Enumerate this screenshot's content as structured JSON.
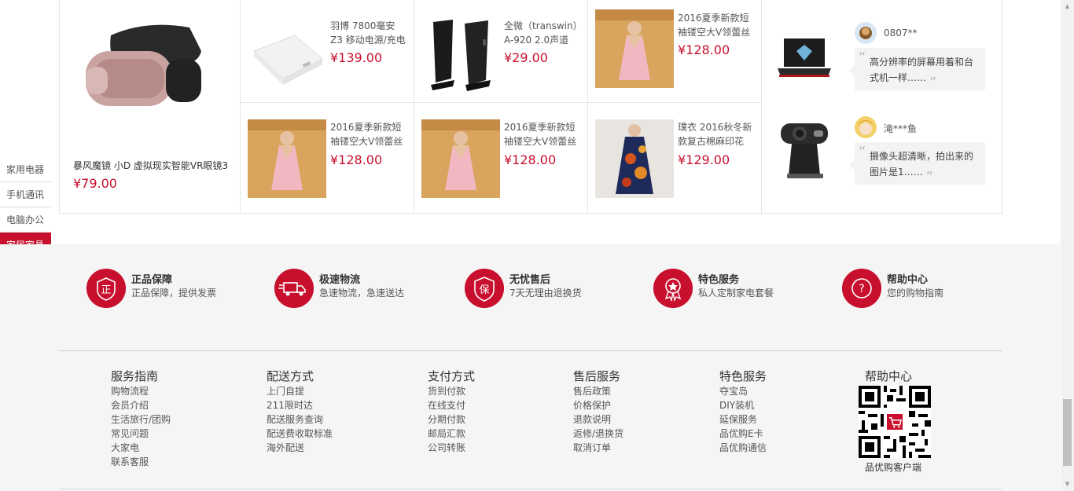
{
  "floor_nav": [
    "家用电器",
    "手机通讯",
    "电脑办公",
    "家居家具"
  ],
  "floor_nav_active": 3,
  "big_product": {
    "name": "暴风魔镜 小D 虚拟现实智能VR眼镜3",
    "price": "¥79.00"
  },
  "products": [
    {
      "name": "羽博 7800毫安 Z3 移动电源/充电",
      "price": "¥139.00"
    },
    {
      "name": "全微（transwin）A-920 2.0声道",
      "price": "¥29.00"
    },
    {
      "name": "2016夏季新款短袖镂空大V领蕾丝",
      "price": "¥128.00"
    },
    {
      "name": "2016夏季新款短袖镂空大V领蕾丝",
      "price": "¥128.00"
    },
    {
      "name": "2016夏季新款短袖镂空大V领蕾丝",
      "price": "¥128.00"
    },
    {
      "name": "璞衣 2016秋冬新款复古棉麻印花",
      "price": "¥129.00"
    }
  ],
  "reviews": [
    {
      "user": "0807**",
      "text": "高分辨率的屏幕用着和台式机一样……"
    },
    {
      "user": "滝***鱼",
      "text": "摄像头超清晰，拍出来的图片是1……"
    }
  ],
  "services": [
    {
      "icon": "正",
      "title": "正品保障",
      "desc": "正品保障，提供发票"
    },
    {
      "icon": "truck",
      "title": "极速物流",
      "desc": "急速物流，急速送达"
    },
    {
      "icon": "保",
      "title": "无忧售后",
      "desc": "7天无理由退换货"
    },
    {
      "icon": "medal",
      "title": "特色服务",
      "desc": "私人定制家电套餐"
    },
    {
      "icon": "?",
      "title": "帮助中心",
      "desc": "您的购物指南"
    }
  ],
  "footer_columns": [
    {
      "title": "服务指南",
      "links": [
        "购物流程",
        "会员介绍",
        "生活旅行/团购",
        "常见问题",
        "大家电",
        "联系客服"
      ]
    },
    {
      "title": "配送方式",
      "links": [
        "上门自提",
        "211限时达",
        "配送服务查询",
        "配送费收取标准",
        "海外配送"
      ]
    },
    {
      "title": "支付方式",
      "links": [
        "货到付款",
        "在线支付",
        "分期付款",
        "邮局汇款",
        "公司转账"
      ]
    },
    {
      "title": "售后服务",
      "links": [
        "售后政策",
        "价格保护",
        "退款说明",
        "返修/退换货",
        "取消订单"
      ]
    },
    {
      "title": "特色服务",
      "links": [
        "夺宝岛",
        "DIY装机",
        "延保服务",
        "品优购E卡",
        "品优购通信"
      ]
    }
  ],
  "help_center": {
    "title": "帮助中心",
    "qr_caption": "品优购客户端"
  },
  "colors": {
    "accent": "#c8102e",
    "service_bg": "#f5f5f5"
  }
}
